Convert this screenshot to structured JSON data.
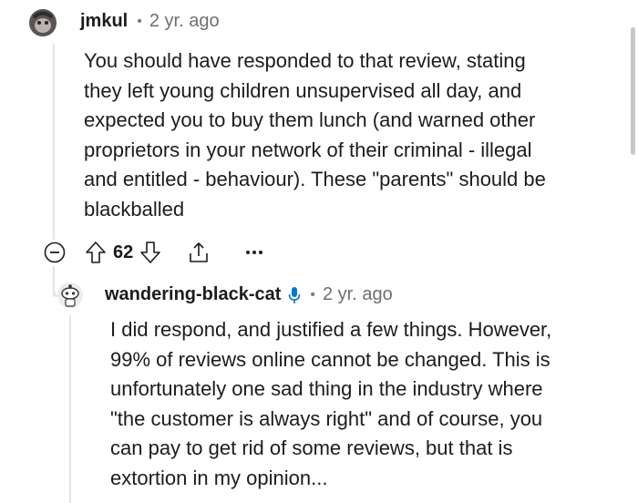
{
  "parent_comment": {
    "username": "jmkul",
    "separator": "•",
    "age": "2 yr. ago",
    "lines": [
      "You should have responded to that review, stating",
      "they left young children unsupervised all day, and",
      "expected you to buy them lunch (and warned other",
      "proprietors in your network of their criminal - illegal",
      "and entitled - behaviour). These \"parents\" should be",
      "blackballed"
    ],
    "vote_count": "62",
    "icons": {
      "collapse": "collapse-icon",
      "upvote": "upvote-arrow-icon",
      "downvote": "downvote-arrow-icon",
      "share": "share-icon",
      "more": "more-options-icon"
    }
  },
  "reply_comment": {
    "username": "wandering-black-cat",
    "separator": "•",
    "age": "2 yr. ago",
    "badge_icon": "microphone-icon",
    "lines": [
      "I did respond, and justified a few things. However,",
      "99% of reviews online cannot be changed. This is",
      "unfortunately one sad thing in the industry where",
      "\"the customer is always right\" and of course, you",
      "can pay to get rid of some reviews, but that is",
      "extortion in my opinion..."
    ]
  },
  "colors": {
    "text": "#1c1c1c",
    "meta": "#6f6f6f",
    "thread": "#e3e5e8",
    "badge": "#0079d3"
  }
}
